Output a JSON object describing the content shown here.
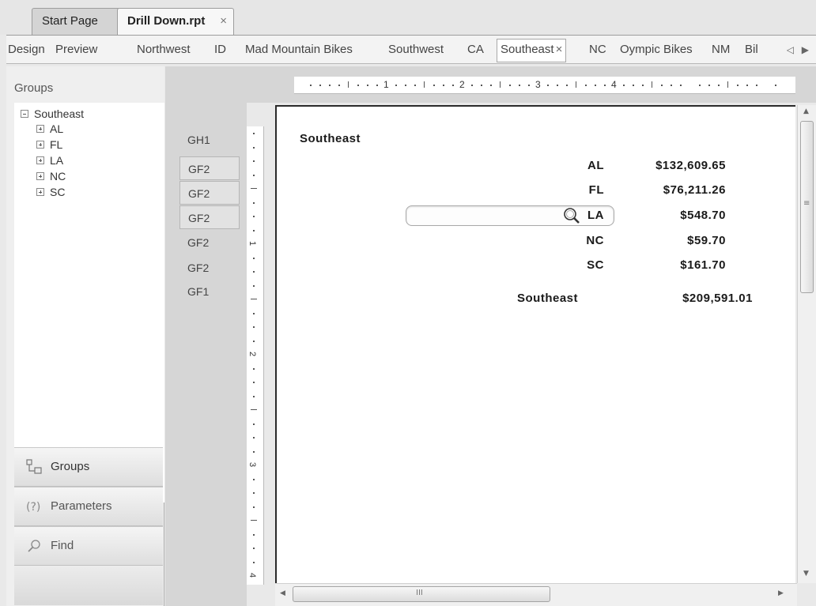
{
  "doc_tabs": {
    "start_page": "Start Page",
    "active": "Drill Down.rpt",
    "close_glyph": "×"
  },
  "drill_tabs": [
    {
      "label": "Design"
    },
    {
      "label": "Preview"
    },
    {
      "label": "Northwest"
    },
    {
      "label": "ID"
    },
    {
      "label": "Mad Mountain Bikes"
    },
    {
      "label": "Southwest"
    },
    {
      "label": "CA"
    },
    {
      "label": "Southeast",
      "selected": true
    },
    {
      "label": "NC"
    },
    {
      "label": "Oympic Bikes"
    },
    {
      "label": "NM"
    },
    {
      "label": "Bil"
    }
  ],
  "drill_tab_close": "×",
  "drill_scroll_arrows": "◁ ▶",
  "left_panel": {
    "header": "Groups",
    "tree": {
      "root": "Southeast",
      "children": [
        "AL",
        "FL",
        "LA",
        "NC",
        "SC"
      ]
    },
    "splitter_dots": "··········",
    "nav": {
      "groups": "Groups",
      "parameters": "Parameters",
      "find": "Find"
    },
    "icons": [
      "groups-tree-icon",
      "parameters-icon",
      "find-icon"
    ]
  },
  "sections": [
    "GH1",
    "GF2",
    "GF2",
    "GF2",
    "GF2",
    "GF2",
    "GF1"
  ],
  "ruler": {
    "h_numbers": [
      "1",
      "2",
      "3",
      "4"
    ],
    "v_numbers": [
      "1",
      "2",
      "3",
      "4"
    ]
  },
  "report": {
    "group_header": "Southeast",
    "rows": [
      {
        "state": "AL",
        "amount": "$132,609.65"
      },
      {
        "state": "FL",
        "amount": "$76,211.26"
      },
      {
        "state": "LA",
        "amount": "$548.70"
      },
      {
        "state": "NC",
        "amount": "$59.70"
      },
      {
        "state": "SC",
        "amount": "$161.70"
      }
    ],
    "total_label": "Southeast",
    "total_amount": "$209,591.01"
  },
  "scrollbars": {
    "v_grip": "≡",
    "h_grip": "III"
  },
  "colors": {
    "background": "#e9e9e9",
    "report_canvas": "#ffffff",
    "gutter": "#d6d6d6"
  }
}
